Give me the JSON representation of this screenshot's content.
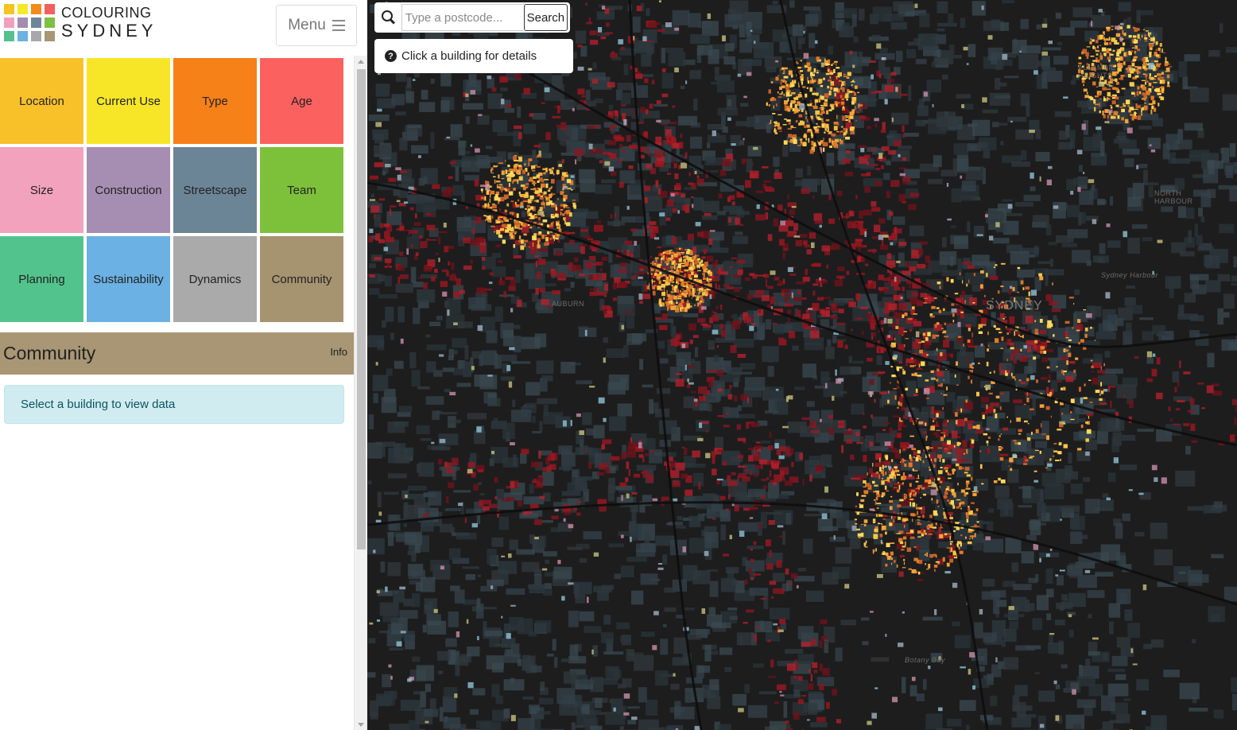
{
  "logo": {
    "line1": "COLOURING",
    "line2": "SYDNEY",
    "squares": [
      "#f5c423",
      "#f6e82a",
      "#f48a1a",
      "#f15f5e",
      "#f0a0bd",
      "#a28cb4",
      "#6e8697",
      "#7cc143",
      "#54c18c",
      "#6cb1e1",
      "#a8a8a8",
      "#a89674"
    ]
  },
  "header": {
    "menu_label": "Menu"
  },
  "categories": [
    {
      "label": "Location",
      "color": "#f8c12a"
    },
    {
      "label": "Current Use",
      "color": "#f7e627"
    },
    {
      "label": "Type",
      "color": "#f68118"
    },
    {
      "label": "Age",
      "color": "#fb615f"
    },
    {
      "label": "Size",
      "color": "#f2a2bc"
    },
    {
      "label": "Construction",
      "color": "#a68eb2"
    },
    {
      "label": "Streetscape",
      "color": "#6c8596"
    },
    {
      "label": "Team",
      "color": "#7dc13a"
    },
    {
      "label": "Planning",
      "color": "#52c38c"
    },
    {
      "label": "Sustainability",
      "color": "#6bb1e3"
    },
    {
      "label": "Dynamics",
      "color": "#aaaaaa"
    },
    {
      "label": "Community",
      "color": "#a6936f"
    }
  ],
  "section": {
    "title": "Community",
    "info_label": "Info",
    "color": "#a89674"
  },
  "notice": {
    "text": "Select a building to view data"
  },
  "search": {
    "placeholder": "Type a postcode...",
    "button_label": "Search"
  },
  "hint": {
    "text": "Click a building for details"
  },
  "map": {
    "labels": {
      "city": "SYDNEY",
      "harbour": "Sydney Harbour",
      "north_harbour": "NORTH HARBOUR",
      "botany_bay": "Botany Bay",
      "allambie": "ALLAMBIE HEIGHTS",
      "auburn": "AUBURN"
    },
    "background_color": "#202020"
  }
}
